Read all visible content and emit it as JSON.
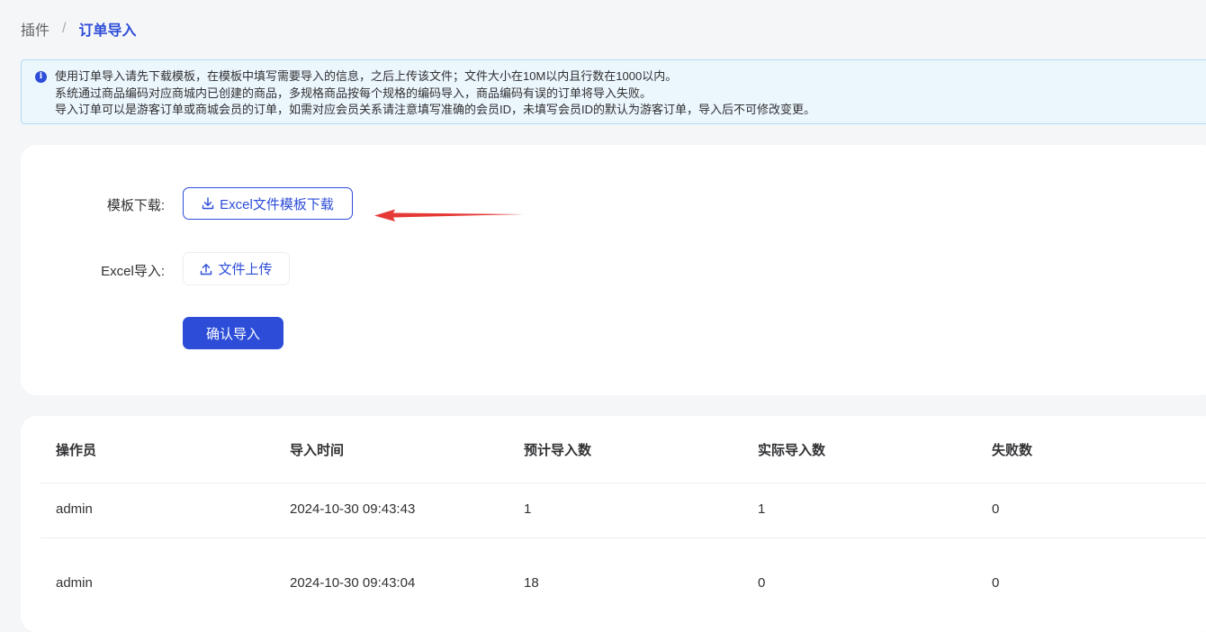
{
  "breadcrumb": {
    "parent": "插件",
    "separator": "/",
    "current": "订单导入"
  },
  "notice": {
    "lines": [
      "使用订单导入请先下载模板，在模板中填写需要导入的信息，之后上传该文件；文件大小在10M以内且行数在1000以内。",
      "系统通过商品编码对应商城内已创建的商品，多规格商品按每个规格的编码导入，商品编码有误的订单将导入失败。",
      "导入订单可以是游客订单或商城会员的订单，如需对应会员关系请注意填写准确的会员ID，未填写会员ID的默认为游客订单，导入后不可修改变更。"
    ]
  },
  "form": {
    "template_label": "模板下载:",
    "template_button": "Excel文件模板下载",
    "import_label": "Excel导入:",
    "upload_button": "文件上传",
    "confirm_button": "确认导入"
  },
  "table": {
    "columns": [
      "操作员",
      "导入时间",
      "预计导入数",
      "实际导入数",
      "失败数"
    ],
    "rows": [
      [
        "admin",
        "2024-10-30 09:43:43",
        "1",
        "1",
        "0"
      ],
      [
        "admin",
        "2024-10-30 09:43:04",
        "18",
        "0",
        "0"
      ]
    ]
  },
  "colors": {
    "primary": "#2d4dd8",
    "arrow": "#e53935",
    "notice_bg": "#ecf6fd"
  }
}
